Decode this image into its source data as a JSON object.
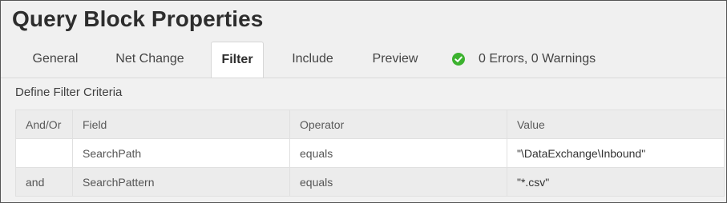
{
  "header": {
    "title": "Query Block Properties"
  },
  "tabs": [
    {
      "label": "General",
      "active": false
    },
    {
      "label": "Net Change",
      "active": false
    },
    {
      "label": "Filter",
      "active": true
    },
    {
      "label": "Include",
      "active": false
    },
    {
      "label": "Preview",
      "active": false
    }
  ],
  "status": {
    "icon": "check-circle-icon",
    "text": "0 Errors, 0 Warnings",
    "color": "#3cb22f"
  },
  "filter": {
    "section_label": "Define Filter Criteria",
    "columns": [
      "And/Or",
      "Field",
      "Operator",
      "Value"
    ],
    "rows": [
      {
        "and_or": "",
        "field": "SearchPath",
        "operator": "equals",
        "value": "\"\\DataExchange\\Inbound\""
      },
      {
        "and_or": "and",
        "field": "SearchPattern",
        "operator": "equals",
        "value": "\"*.csv\""
      }
    ]
  }
}
